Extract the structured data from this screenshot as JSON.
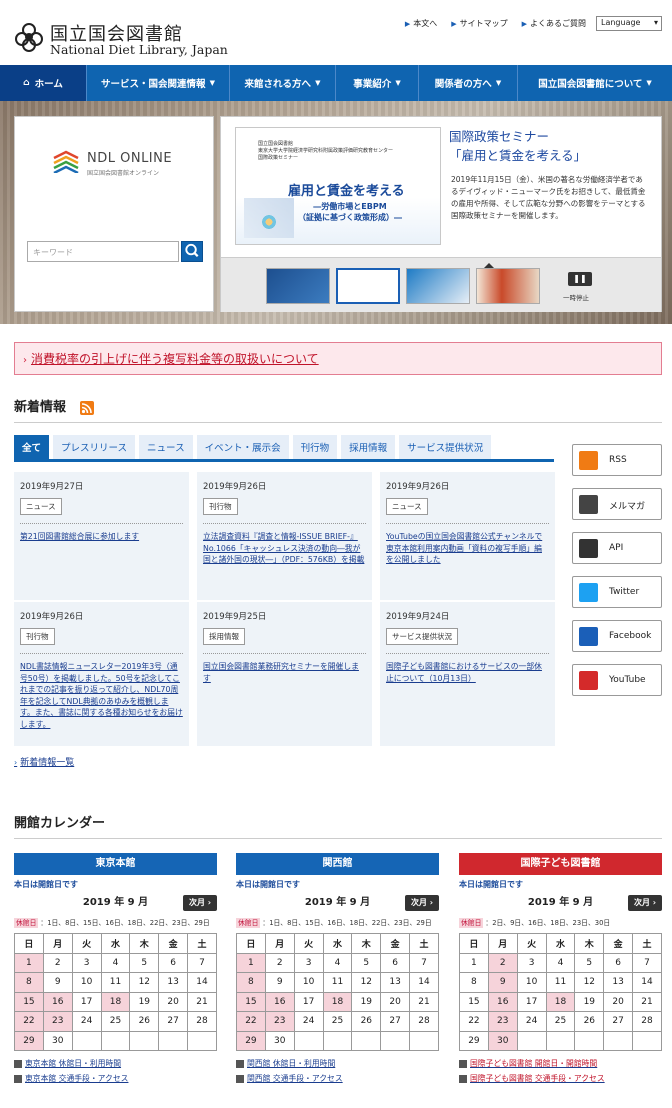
{
  "header": {
    "logo_ja": "国立国会図書館",
    "logo_en": "National Diet Library, Japan",
    "links": [
      "本文へ",
      "サイトマップ",
      "よくあるご質問"
    ],
    "language": "Language"
  },
  "nav": {
    "items": [
      "ホーム",
      "サービス・国会関連情報",
      "来館される方へ",
      "事業紹介",
      "関係者の方へ",
      "国立国会図書館について"
    ]
  },
  "ndl_online": {
    "title": "NDL ONLINE",
    "subtitle": "国立国会図書館オンライン",
    "search_placeholder": "キーワード"
  },
  "slider": {
    "banner_small": "国立国会図書館\n東京大学大学院経済学研究科附属政策評価研究教育センター\n国際政策セミナー",
    "banner_main": "雇用と賃金を考える",
    "banner_sub": "―労働市場とEBPM\n（証拠に基づく政策形成）―",
    "title_line1": "国際政策セミナー",
    "title_line2": "「雇用と賃金を考える」",
    "description": "2019年11月15日（金）、米国の著名な労働経済学者であるデイヴィッド・ニューマーク氏をお招きして、最低賃金の雇用や所得、そして広範な分野への影響をテーマとする国際政策セミナーを開催します。",
    "pause_label": "一時停止"
  },
  "notice": {
    "text": "消費税率の引上げに伴う複写料金等の取扱いについて"
  },
  "news": {
    "heading": "新着情報",
    "tabs": [
      "全て",
      "プレスリリース",
      "ニュース",
      "イベント・展示会",
      "刊行物",
      "採用情報",
      "サービス提供状況"
    ],
    "items": [
      {
        "date": "2019年9月27日",
        "tag": "ニュース",
        "text": "第21回図書館総合展に参加します"
      },
      {
        "date": "2019年9月26日",
        "tag": "刊行物",
        "text": "立法調査資料『調査と情報-ISSUE BRIEF-』No.1066「キャッシュレス決済の動向―我が国と諸外国の現状―」（PDF：576KB）を掲載"
      },
      {
        "date": "2019年9月26日",
        "tag": "ニュース",
        "text": "YouTubeの国立国会図書館公式チャンネルで東京本館利用案内動画「資料の複写手順」編を公開しました"
      },
      {
        "date": "2019年9月26日",
        "tag": "刊行物",
        "text": "NDL書誌情報ニュースレター2019年3号（通号50号）を掲載しました。50号を記念してこれまでの記事を振り返って紹介し、NDL70周年を記念してNDL典拠のあゆみを概観します。また、書誌に関する各種お知らせをお届けします。"
      },
      {
        "date": "2019年9月25日",
        "tag": "採用情報",
        "text": "国立国会図書館業務研究セミナーを開催します"
      },
      {
        "date": "2019年9月24日",
        "tag": "サービス提供状況",
        "text": "国際子ども図書館におけるサービスの一部休止について（10月13日）"
      }
    ],
    "more": "新着情報一覧"
  },
  "social": [
    "RSS",
    "メルマガ",
    "API",
    "Twitter",
    "Facebook",
    "YouTube"
  ],
  "calendar": {
    "heading": "開館カレンダー",
    "today": "本日は開館日です",
    "month": "2019 年 9 月",
    "next": "次月",
    "closed_label": "休館日",
    "weekdays": [
      "日",
      "月",
      "火",
      "水",
      "木",
      "金",
      "土"
    ],
    "libraries": [
      {
        "name": "東京本館",
        "color": "#1565b5",
        "closed": "1日、8日、15日、16日、18日、22日、23日、29日",
        "links": [
          "東京本館 休館日・利用時間",
          "東京本館 交通手段・アクセス"
        ],
        "holidays": [
          1,
          8,
          15,
          16,
          18,
          22,
          23,
          29
        ]
      },
      {
        "name": "関西館",
        "color": "#1565b5",
        "closed": "1日、8日、15日、16日、18日、22日、23日、29日",
        "links": [
          "関西館 休館日・利用時間",
          "関西館 交通手段・アクセス"
        ],
        "holidays": [
          1,
          8,
          15,
          16,
          18,
          22,
          23,
          29
        ]
      },
      {
        "name": "国際子ども図書館",
        "color": "#d0282e",
        "closed": "2日、9日、16日、18日、23日、30日",
        "links": [
          "国際子ども図書館 開館日・開館時間",
          "国際子ども図書館 交通手段・アクセス"
        ],
        "holidays": [
          2,
          9,
          16,
          18,
          23,
          30
        ]
      }
    ],
    "weeks": [
      [
        1,
        2,
        3,
        4,
        5,
        6,
        7
      ],
      [
        8,
        9,
        10,
        11,
        12,
        13,
        14
      ],
      [
        15,
        16,
        17,
        18,
        19,
        20,
        21
      ],
      [
        22,
        23,
        24,
        25,
        26,
        27,
        28
      ],
      [
        29,
        30,
        null,
        null,
        null,
        null,
        null
      ]
    ]
  }
}
